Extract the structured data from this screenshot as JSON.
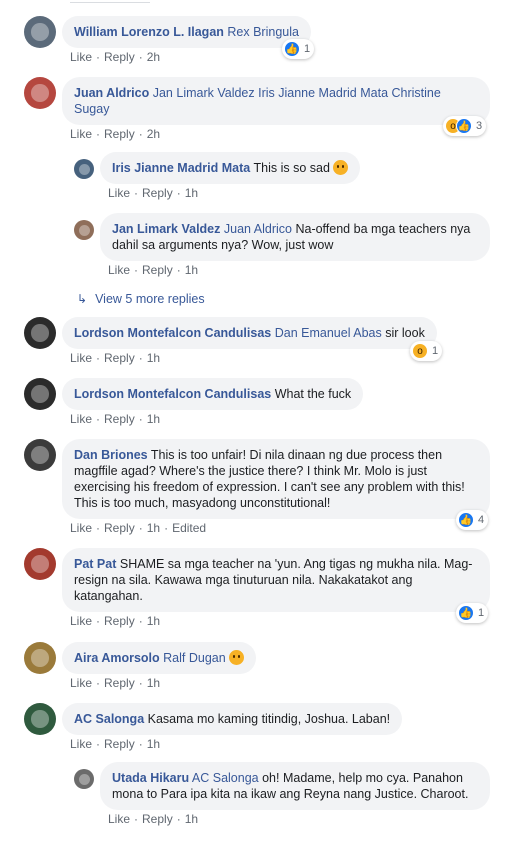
{
  "actions": {
    "like": "Like",
    "reply": "Reply",
    "separator": "·"
  },
  "colors": {
    "link": "#385898",
    "bubble": "#f2f3f5",
    "like": "#1877f2",
    "wow": "#f7b125"
  },
  "comments": [
    {
      "author": "William Lorenzo L. Ilagan",
      "tags": "Rex Bringula",
      "text": "",
      "time": "2h",
      "reactions": {
        "types": [
          "like-icon"
        ],
        "count": "1"
      }
    },
    {
      "author": "Juan Aldrico",
      "tags": "Jan Limark Valdez Iris Jianne Madrid Mata Christine Sugay",
      "text": "",
      "time": "2h",
      "reactions": {
        "types": [
          "wow-icon",
          "like-icon"
        ],
        "count": "3"
      }
    },
    {
      "author": "Iris Jianne Madrid Mata",
      "tags": "",
      "text": "This is so sad",
      "time": "1h",
      "emoji": "sad-emoji"
    },
    {
      "author": "Jan Limark Valdez",
      "tags": "Juan Aldrico",
      "text": "Na-offend ba mga teachers nya dahil sa arguments nya? Wow, just wow",
      "time": "1h"
    },
    {
      "author": "Lordson Montefalcon Candulisas",
      "tags": "Dan Emanuel Abas",
      "text": "sir look",
      "time": "1h",
      "reactions": {
        "types": [
          "wow-icon"
        ],
        "count": "1"
      }
    },
    {
      "author": "Lordson Montefalcon Candulisas",
      "tags": "",
      "text": "What the fuck",
      "time": "1h"
    },
    {
      "author": "Dan Briones",
      "tags": "",
      "text": "This is too unfair! Di nila dinaan ng due process then magffile agad? Where's the justice there? I think Mr. Molo is just exercising his freedom of expression. I can't see any problem with this! This is too much, masyadong unconstitutional!",
      "time": "1h",
      "edited": "Edited",
      "reactions": {
        "types": [
          "like-icon"
        ],
        "count": "4"
      }
    },
    {
      "author": "Pat Pat",
      "tags": "",
      "text": "SHAME sa mga teacher na 'yun. Ang tigas ng mukha nila. Mag-resign na sila. Kawawa mga tinuturuan nila. Nakakatakot ang katangahan.",
      "time": "1h",
      "reactions": {
        "types": [
          "like-icon"
        ],
        "count": "1"
      }
    },
    {
      "author": "Aira Amorsolo",
      "tags": "Ralf Dugan",
      "text": "",
      "time": "1h",
      "emoji": "crying-emoji"
    },
    {
      "author": "AC Salonga",
      "tags": "",
      "text": "Kasama mo kaming titindig, Joshua. Laban!",
      "time": "1h"
    },
    {
      "author": "Utada Hikaru",
      "tags": "AC Salonga",
      "text": "oh! Madame, help mo cya. Panahon mona to Para ipa kita na ikaw ang Reyna nang Justice. Charoot.",
      "time": "1h"
    }
  ],
  "view_more": "View 5 more replies"
}
